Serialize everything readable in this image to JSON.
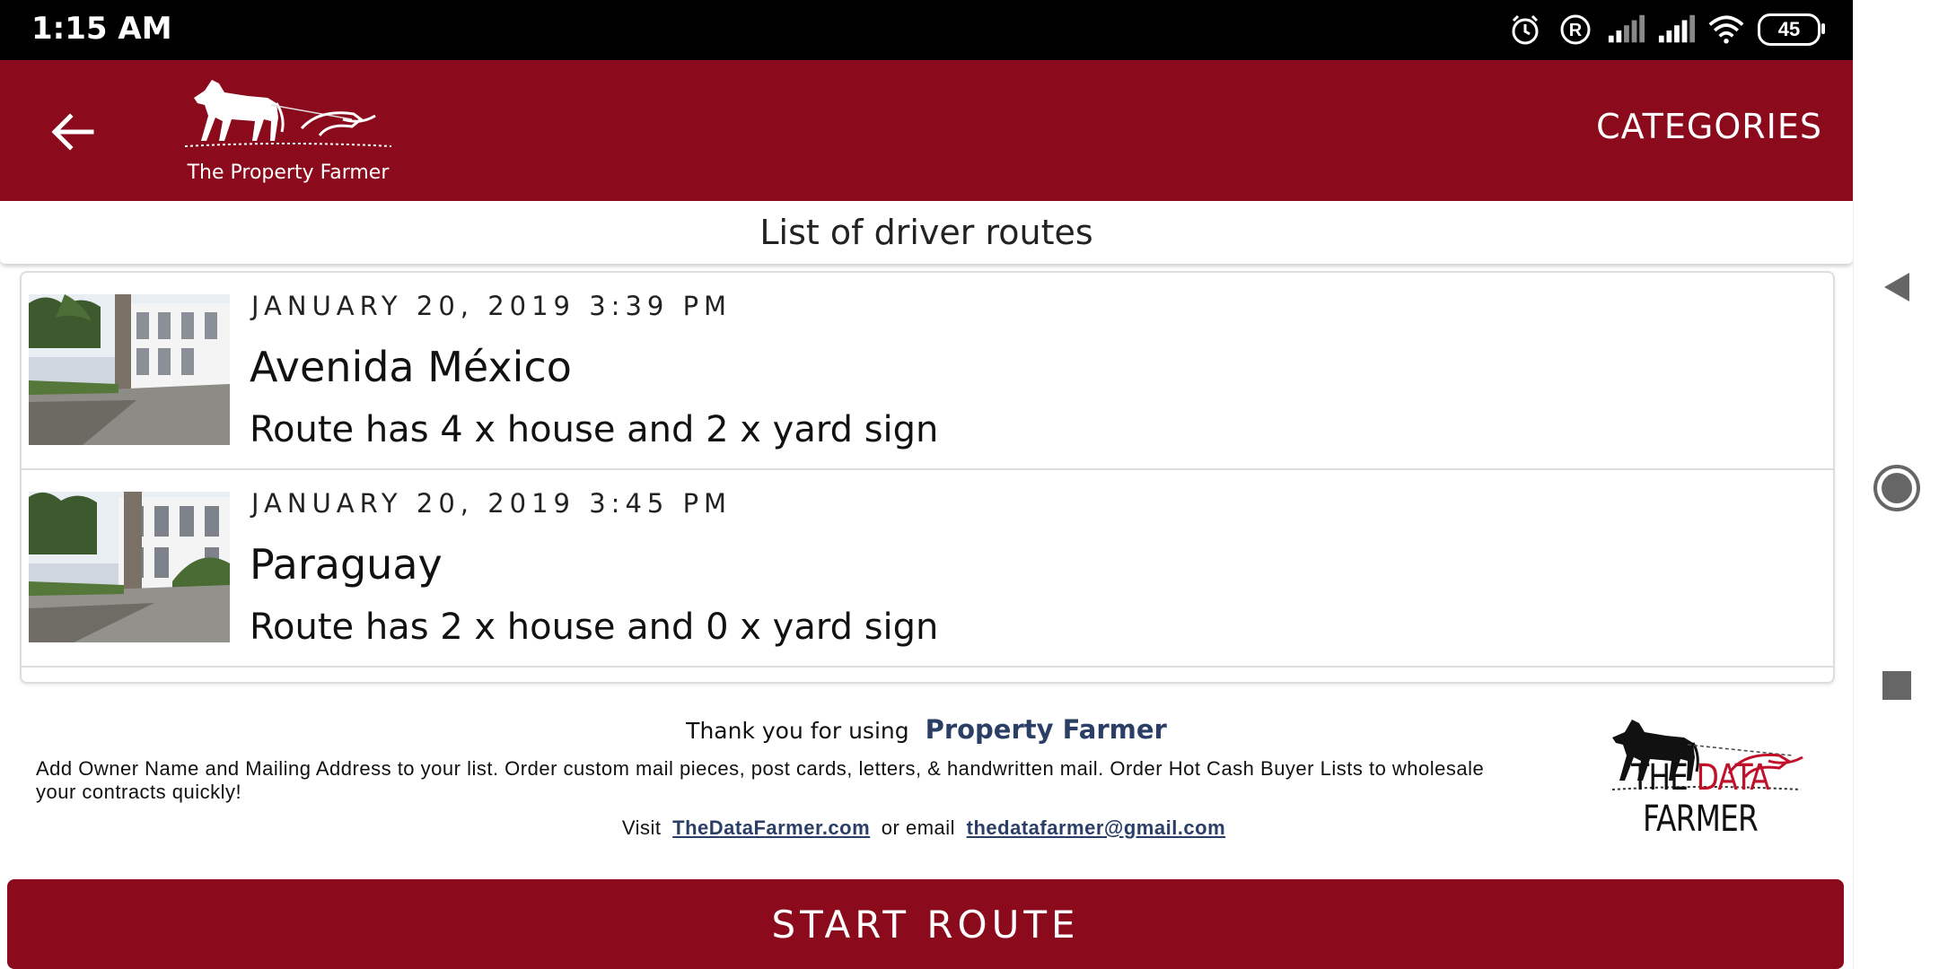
{
  "status_bar": {
    "time": "1:15 AM",
    "icons": [
      "alarm-icon",
      "registered-icon",
      "signal-icon",
      "signal-icon",
      "wifi-icon"
    ],
    "battery": "45"
  },
  "app_bar": {
    "back_icon": "arrow-left-icon",
    "logo_text": "The Property Farmer",
    "categories_label": "CATEGORIES",
    "color": "#8b0a1b"
  },
  "list": {
    "title": "List of driver routes",
    "routes": [
      {
        "date": "JANUARY 20, 2019 3:39 PM",
        "name": "Avenida México",
        "summary": "Route has 4 x house and 2 x yard sign"
      },
      {
        "date": "JANUARY 20, 2019 3:45 PM",
        "name": "Paraguay",
        "summary": "Route has 2 x house and 0 x yard sign"
      }
    ]
  },
  "footer": {
    "thanks_prefix": "Thank you for using",
    "thanks_brand": "Property Farmer",
    "promo": "Add Owner Name and Mailing Address to your list. Order custom mail pieces, post cards, letters, & handwritten mail. Order Hot Cash Buyer Lists to wholesale your contracts quickly!",
    "visit_prefix": "Visit",
    "site_link": "TheDataFarmer.com",
    "or_email": "or email",
    "email_link": "thedatafarmer@gmail.com",
    "logo_text_a": "THE ",
    "logo_text_b": "DATA",
    "logo_text_c": " FARMER"
  },
  "start_button": {
    "label": "START ROUTE"
  },
  "nav_bar": {
    "icons": [
      "back-triangle-icon",
      "home-circle-icon",
      "recents-square-icon"
    ]
  }
}
